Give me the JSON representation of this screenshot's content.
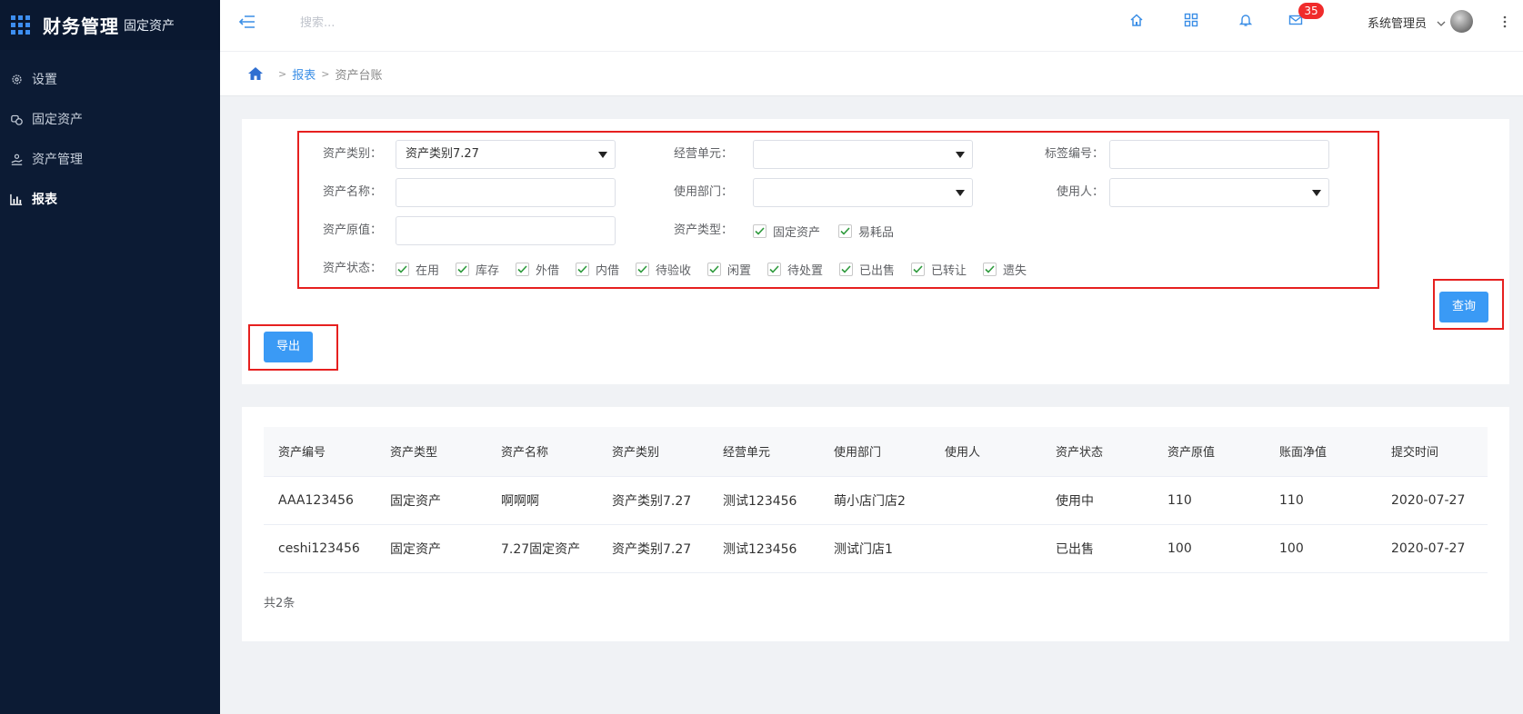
{
  "sidebar": {
    "title": "财务管理",
    "subtitle": "固定资产",
    "items": [
      {
        "label": "设置",
        "icon": "gear-icon"
      },
      {
        "label": "固定资产",
        "icon": "coins-icon"
      },
      {
        "label": "资产管理",
        "icon": "hand-icon"
      },
      {
        "label": "报表",
        "icon": "bar-chart-icon"
      }
    ]
  },
  "header": {
    "search_placeholder": "搜索...",
    "badge_count": "35",
    "user_name": "系统管理员"
  },
  "breadcrumb": {
    "link": "报表",
    "current": "资产台账",
    "separator": ">"
  },
  "filters": {
    "asset_category": {
      "label": "资产类别：",
      "value": "资产类别7.27"
    },
    "business_unit": {
      "label": "经营单元：",
      "value": ""
    },
    "tag_number": {
      "label": "标签编号：",
      "value": ""
    },
    "asset_name": {
      "label": "资产名称：",
      "value": ""
    },
    "department": {
      "label": "使用部门：",
      "value": ""
    },
    "user": {
      "label": "使用人：",
      "value": ""
    },
    "original_value": {
      "label": "资产原值：",
      "value": ""
    },
    "asset_type": {
      "label": "资产类型：",
      "options": [
        {
          "label": "固定资产",
          "checked": true
        },
        {
          "label": "易耗品",
          "checked": true
        }
      ]
    },
    "asset_status": {
      "label": "资产状态：",
      "options": [
        {
          "label": "在用",
          "checked": true
        },
        {
          "label": "库存",
          "checked": true
        },
        {
          "label": "外借",
          "checked": true
        },
        {
          "label": "内借",
          "checked": true
        },
        {
          "label": "待验收",
          "checked": true
        },
        {
          "label": "闲置",
          "checked": true
        },
        {
          "label": "待处置",
          "checked": true
        },
        {
          "label": "已出售",
          "checked": true
        },
        {
          "label": "已转让",
          "checked": true
        },
        {
          "label": "遗失",
          "checked": true
        }
      ]
    }
  },
  "buttons": {
    "query": "查询",
    "export": "导出"
  },
  "table": {
    "columns": [
      "资产编号",
      "资产类型",
      "资产名称",
      "资产类别",
      "经营单元",
      "使用部门",
      "使用人",
      "资产状态",
      "资产原值",
      "账面净值",
      "提交时间"
    ],
    "rows": [
      [
        "AAA123456",
        "固定资产",
        "啊啊啊",
        "资产类别7.27",
        "测试123456",
        "萌小店门店2",
        "",
        "使用中",
        "110",
        "110",
        "2020-07-27"
      ],
      [
        "ceshi123456",
        "固定资产",
        "7.27固定资产",
        "资产类别7.27",
        "测试123456",
        "测试门店1",
        "",
        "已出售",
        "100",
        "100",
        "2020-07-27"
      ]
    ],
    "total": "共2条"
  },
  "colors": {
    "sidebar_bg": "#0c1b34",
    "accent": "#3a9af5",
    "highlight_box": "#e6201f",
    "badge": "#f02b2b"
  }
}
